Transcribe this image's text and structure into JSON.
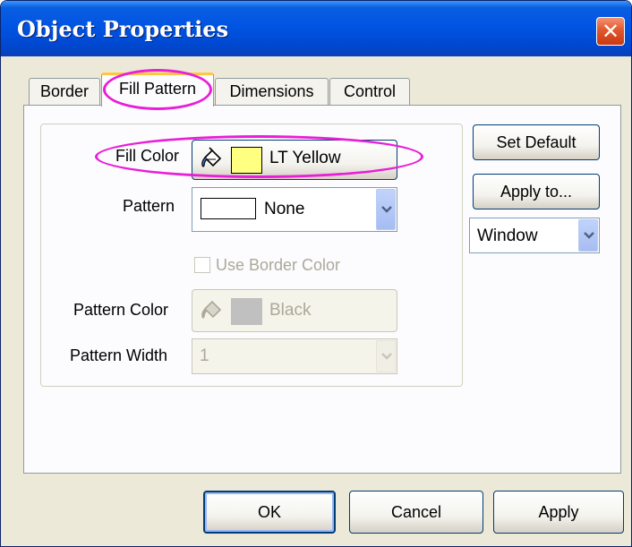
{
  "window": {
    "title": "Object Properties"
  },
  "tabs": [
    {
      "label": "Border",
      "active": false
    },
    {
      "label": "Fill Pattern",
      "active": true
    },
    {
      "label": "Dimensions",
      "active": false
    },
    {
      "label": "Control",
      "active": false
    }
  ],
  "fill_pattern": {
    "fill_color": {
      "label": "Fill Color",
      "value": "LT Yellow",
      "swatch": "#ffff80"
    },
    "pattern": {
      "label": "Pattern",
      "value": "None"
    },
    "use_border_color": {
      "label": "Use Border Color",
      "checked": false,
      "enabled": false
    },
    "pattern_color": {
      "label": "Pattern Color",
      "value": "Black",
      "swatch": "#c0c0c0",
      "enabled": false
    },
    "pattern_width": {
      "label": "Pattern Width",
      "value": "1",
      "enabled": false
    }
  },
  "side": {
    "set_default": "Set Default",
    "apply_to": "Apply to...",
    "scope": "Window"
  },
  "footer": {
    "ok": "OK",
    "cancel": "Cancel",
    "apply": "Apply"
  },
  "colors": {
    "titlebar": "#0054e3",
    "dialog_bg": "#ece9d8",
    "highlight": "#e81ed8",
    "active_tab_accent": "#ffc83c"
  },
  "icons": [
    "close-icon",
    "paint-bucket-icon",
    "dropdown-arrow-icon"
  ]
}
